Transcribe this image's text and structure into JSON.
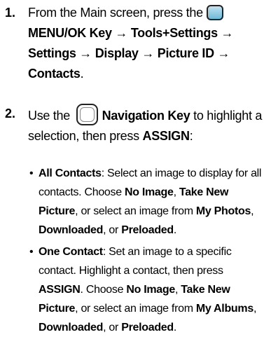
{
  "steps": [
    {
      "number": "1.",
      "parts": [
        {
          "text": "From the Main screen, press the ",
          "bold": false
        },
        {
          "icon": "menu-ok-key-icon"
        },
        {
          "text": "MENU/OK Key → Tools+Settings → Settings → Display → Picture ID → Contacts",
          "bold": true
        },
        {
          "text": ".",
          "bold": false
        }
      ]
    },
    {
      "number": "2.",
      "parts": [
        {
          "text": "Use the ",
          "bold": false
        },
        {
          "icon": "navigation-key-icon"
        },
        {
          "text": "Navigation Key",
          "bold": true
        },
        {
          "text": " to highlight a selection, then press ",
          "bold": false
        },
        {
          "text": "ASSIGN",
          "bold": true
        },
        {
          "text": ":",
          "bold": false
        }
      ]
    }
  ],
  "bullets": [
    {
      "parts": [
        {
          "text": "All Contacts",
          "bold": true
        },
        {
          "text": ": Select an image to display for all contacts. Choose ",
          "bold": false
        },
        {
          "text": "No Image",
          "bold": true
        },
        {
          "text": ", ",
          "bold": false
        },
        {
          "text": "Take New Picture",
          "bold": true
        },
        {
          "text": ", or select an image from ",
          "bold": false
        },
        {
          "text": "My Photos",
          "bold": true
        },
        {
          "text": ", ",
          "bold": false
        },
        {
          "text": "Downloaded",
          "bold": true
        },
        {
          "text": ", or ",
          "bold": false
        },
        {
          "text": "Preloaded",
          "bold": true
        },
        {
          "text": ".",
          "bold": false
        }
      ]
    },
    {
      "parts": [
        {
          "text": "One Contact",
          "bold": true
        },
        {
          "text": ": Set an image to a specific contact. Highlight a contact, then press ",
          "bold": false
        },
        {
          "text": "ASSIGN",
          "bold": true
        },
        {
          "text": ". Choose ",
          "bold": false
        },
        {
          "text": "No Image",
          "bold": true
        },
        {
          "text": ", ",
          "bold": false
        },
        {
          "text": "Take New Picture",
          "bold": true
        },
        {
          "text": ", or select an image from ",
          "bold": false
        },
        {
          "text": "My Albums",
          "bold": true
        },
        {
          "text": ", ",
          "bold": false
        },
        {
          "text": "Downloaded",
          "bold": true
        },
        {
          "text": ", or ",
          "bold": false
        },
        {
          "text": "Preloaded",
          "bold": true
        },
        {
          "text": ".",
          "bold": false
        }
      ]
    }
  ],
  "bullet_glyph": "•",
  "colors": {
    "text": "#000000",
    "menu_key_fill": "#6fb9d8",
    "key_border": "#222222"
  }
}
